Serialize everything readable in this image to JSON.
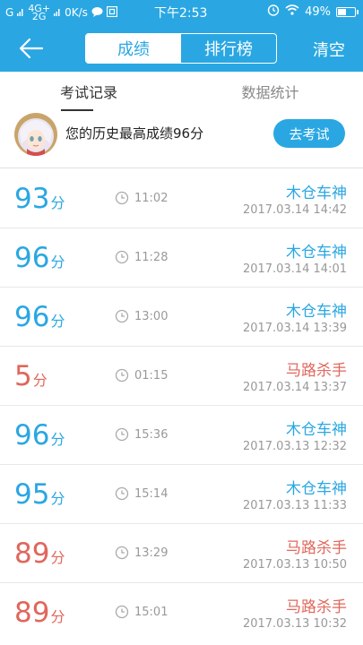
{
  "status_bar": {
    "signal": "G",
    "net_top": "4G+",
    "net_bottom": "2G",
    "speed": "0K/s",
    "time": "下午2:53",
    "battery": "49%"
  },
  "header": {
    "tabs": [
      {
        "label": "成绩",
        "active": true
      },
      {
        "label": "排行榜",
        "active": false
      }
    ],
    "clear_label": "清空"
  },
  "sub_tabs": [
    {
      "label": "考试记录",
      "active": true
    },
    {
      "label": "数据统计",
      "active": false
    }
  ],
  "best": {
    "text": "您的历史最高成绩96分",
    "button_label": "去考试"
  },
  "records": [
    {
      "score": "93",
      "unit": "分",
      "duration": "11:02",
      "title": "木仓车神",
      "date": "2017.03.14  14:42",
      "status": "pass"
    },
    {
      "score": "96",
      "unit": "分",
      "duration": "11:28",
      "title": "木仓车神",
      "date": "2017.03.14  14:01",
      "status": "pass"
    },
    {
      "score": "96",
      "unit": "分",
      "duration": "13:00",
      "title": "木仓车神",
      "date": "2017.03.14  13:39",
      "status": "pass"
    },
    {
      "score": "5",
      "unit": "分",
      "duration": "01:15",
      "title": "马路杀手",
      "date": "2017.03.14  13:37",
      "status": "fail"
    },
    {
      "score": "96",
      "unit": "分",
      "duration": "15:36",
      "title": "木仓车神",
      "date": "2017.03.13  12:32",
      "status": "pass"
    },
    {
      "score": "95",
      "unit": "分",
      "duration": "15:14",
      "title": "木仓车神",
      "date": "2017.03.13  11:33",
      "status": "pass"
    },
    {
      "score": "89",
      "unit": "分",
      "duration": "13:29",
      "title": "马路杀手",
      "date": "2017.03.13  10:50",
      "status": "fail"
    },
    {
      "score": "89",
      "unit": "分",
      "duration": "15:01",
      "title": "马路杀手",
      "date": "2017.03.13  10:32",
      "status": "fail"
    }
  ],
  "colors": {
    "accent": "#2aa7e2",
    "fail": "#e0675b"
  }
}
